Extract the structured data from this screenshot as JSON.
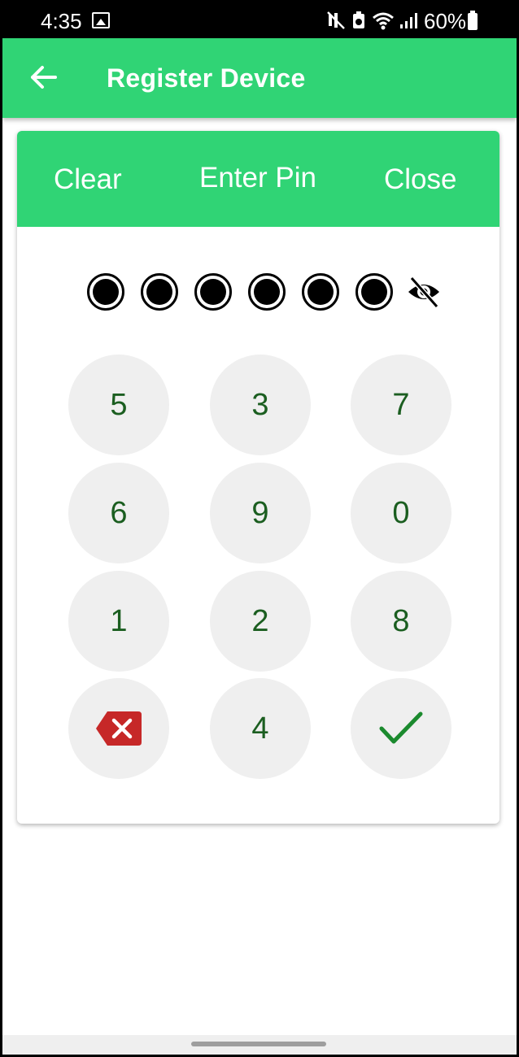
{
  "status_bar": {
    "time": "4:35",
    "battery": "60%",
    "icons": [
      "image-icon",
      "mute-icon",
      "data-saver-icon",
      "wifi-icon",
      "signal-icon",
      "battery-icon"
    ]
  },
  "app_bar": {
    "title": "Register Device",
    "back_icon": "arrow-left-icon",
    "color": "#30d475"
  },
  "pin_dialog": {
    "clear_label": "Clear",
    "title": "Enter Pin",
    "close_label": "Close",
    "entered_digits": 6,
    "visibility_icon": "eye-off-icon"
  },
  "keypad": {
    "keys": [
      {
        "label": "5",
        "type": "digit"
      },
      {
        "label": "3",
        "type": "digit"
      },
      {
        "label": "7",
        "type": "digit"
      },
      {
        "label": "6",
        "type": "digit"
      },
      {
        "label": "9",
        "type": "digit"
      },
      {
        "label": "0",
        "type": "digit"
      },
      {
        "label": "1",
        "type": "digit"
      },
      {
        "label": "2",
        "type": "digit"
      },
      {
        "label": "8",
        "type": "digit"
      },
      {
        "label": "",
        "type": "backspace",
        "icon": "backspace-icon",
        "color": "#c62828"
      },
      {
        "label": "4",
        "type": "digit"
      },
      {
        "label": "",
        "type": "confirm",
        "icon": "check-icon",
        "color": "#1b8a2e"
      }
    ],
    "digit_color": "#1b5e20",
    "key_background": "#efefef"
  }
}
